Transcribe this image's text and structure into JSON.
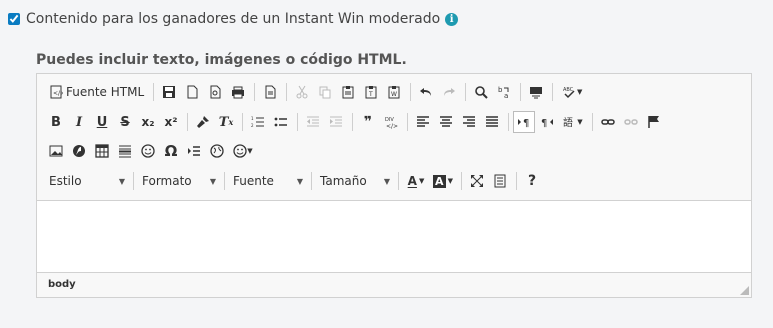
{
  "checkbox": {
    "label": "Contenido para los ganadores de un Instant Win moderado",
    "checked": true,
    "info_icon": "info-icon"
  },
  "section_label": "Puedes incluir texto, imágenes o código HTML.",
  "toolbar": {
    "source_label": "Fuente HTML",
    "bold": "B",
    "italic": "I",
    "underline": "U",
    "strike": "S",
    "subscript": "x₂",
    "superscript": "x²",
    "remove_format": "Tx",
    "blockquote": "❞",
    "omega": "Ω",
    "help": "?",
    "combos": {
      "style": "Estilo",
      "format": "Formato",
      "font": "Fuente",
      "size": "Tamaño"
    },
    "text_color": "A",
    "bg_color": "A"
  },
  "statusbar": {
    "path": "body"
  }
}
